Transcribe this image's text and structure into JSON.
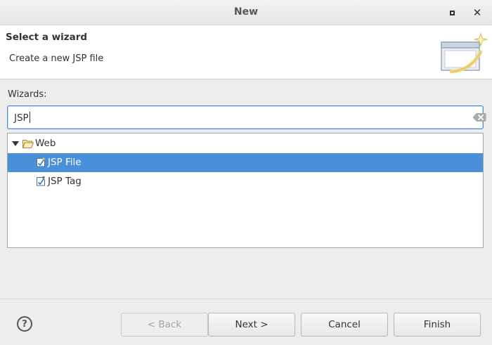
{
  "window": {
    "title": "New"
  },
  "banner": {
    "heading": "Select a wizard",
    "description": "Create a new JSP file"
  },
  "wizards": {
    "label": "Wizards:",
    "filter_value": "JSP"
  },
  "tree": {
    "folder": {
      "label": "Web",
      "expanded": true,
      "icon": "folder-open-icon"
    },
    "items": [
      {
        "label": "JSP File",
        "selected": true,
        "icon": "jsp-file-icon"
      },
      {
        "label": "JSP Tag",
        "selected": false,
        "icon": "jsp-tag-icon"
      }
    ]
  },
  "buttons": {
    "help": "?",
    "back": "< Back",
    "next": "Next >",
    "cancel": "Cancel",
    "finish": "Finish"
  },
  "colors": {
    "selection": "#4a90d9",
    "focus_border": "#4a90d9",
    "banner_bg": "#ffffff",
    "window_bg": "#ededed"
  }
}
